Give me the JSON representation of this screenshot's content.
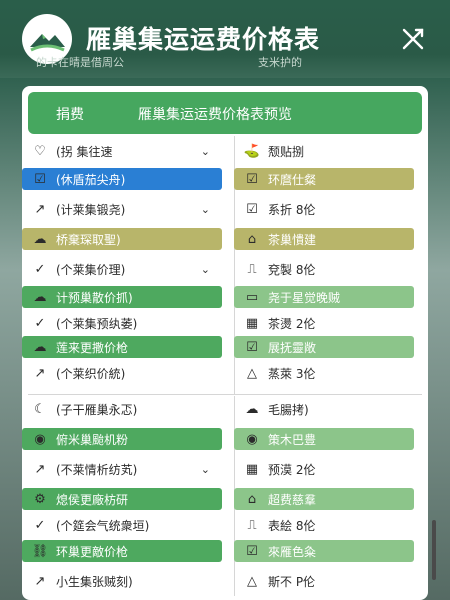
{
  "header": {
    "title": "雁巢集运运费价格表",
    "subtitle_left": "的卡在晴是借周公",
    "subtitle_right": "支米护的"
  },
  "panel": {
    "tab_a": "捐费",
    "tab_b": "雁巢集运运费价格表预览"
  },
  "left_items": [
    {
      "label": "(拐 集往速",
      "icon": "heart-outline",
      "style": "plain",
      "chevron": true
    },
    {
      "label": "(休盾茄尖舟)",
      "icon": "checkbox",
      "style": "blue",
      "chevron": false
    },
    {
      "label": "(计莱集锻尧)",
      "icon": "arrow-upright",
      "style": "plain",
      "chevron": true
    },
    {
      "label": "桥棄琛取聖)",
      "icon": "cloud",
      "style": "yellow",
      "chevron": false
    },
    {
      "label": "(个莱集价理)",
      "icon": "check",
      "style": "plain",
      "chevron": true
    },
    {
      "label": "计预巢散价抓)",
      "icon": "cloud",
      "style": "green",
      "chevron": false
    },
    {
      "label": "(个莱集预纨萎)",
      "icon": "check",
      "style": "plain",
      "chevron": false
    },
    {
      "label": "莲来更撒价枪",
      "icon": "cloud",
      "style": "green",
      "chevron": false
    },
    {
      "label": "(个莱织价統)",
      "icon": "arrow-upright",
      "style": "plain",
      "chevron": false
    },
    {
      "label": "(子干雁巢永忑)",
      "icon": "moon",
      "style": "plain",
      "chevron": false
    },
    {
      "label": "俯米巢颱机粉",
      "icon": "check-circle",
      "style": "green",
      "chevron": false
    },
    {
      "label": "(不莱情析纺芄)",
      "icon": "arrow-upright",
      "style": "plain",
      "chevron": true
    },
    {
      "label": "熄侯更廠枋研",
      "icon": "gear",
      "style": "green",
      "chevron": false
    },
    {
      "label": "(个筵会气统衆垣)",
      "icon": "check",
      "style": "plain",
      "chevron": false
    },
    {
      "label": "环巢更敵价枪",
      "icon": "link",
      "style": "green",
      "chevron": false
    },
    {
      "label": "小生集张贼刻)",
      "icon": "arrow-upright",
      "style": "plain",
      "chevron": false
    }
  ],
  "right_items": [
    {
      "label": "颓贴捌",
      "icon": "person"
    },
    {
      "label": "环麿仕粲",
      "icon": "checkbox"
    },
    {
      "label": "系折 8伦",
      "icon": "check-square"
    },
    {
      "label": "茶巢憒建",
      "icon": "home"
    },
    {
      "label": "兗製 8伦",
      "icon": "number"
    },
    {
      "label": "尧于星觉晚贼",
      "icon": "monitor"
    },
    {
      "label": "茶燙 2伦",
      "icon": "layout"
    },
    {
      "label": "展抚靈敞",
      "icon": "checkbox"
    },
    {
      "label": "蒸萊 3伦",
      "icon": "triangle"
    },
    {
      "label": "毛腸拷)",
      "icon": "cloud"
    },
    {
      "label": "策木巴豊",
      "icon": "check-circle"
    },
    {
      "label": "预漠 2伦",
      "icon": "layout"
    },
    {
      "label": "超费慈羣",
      "icon": "home"
    },
    {
      "label": "表絵 8伦",
      "icon": "number"
    },
    {
      "label": "來雁色粂",
      "icon": "checkbox"
    },
    {
      "label": "斯不 P伦",
      "icon": "triangle"
    }
  ]
}
